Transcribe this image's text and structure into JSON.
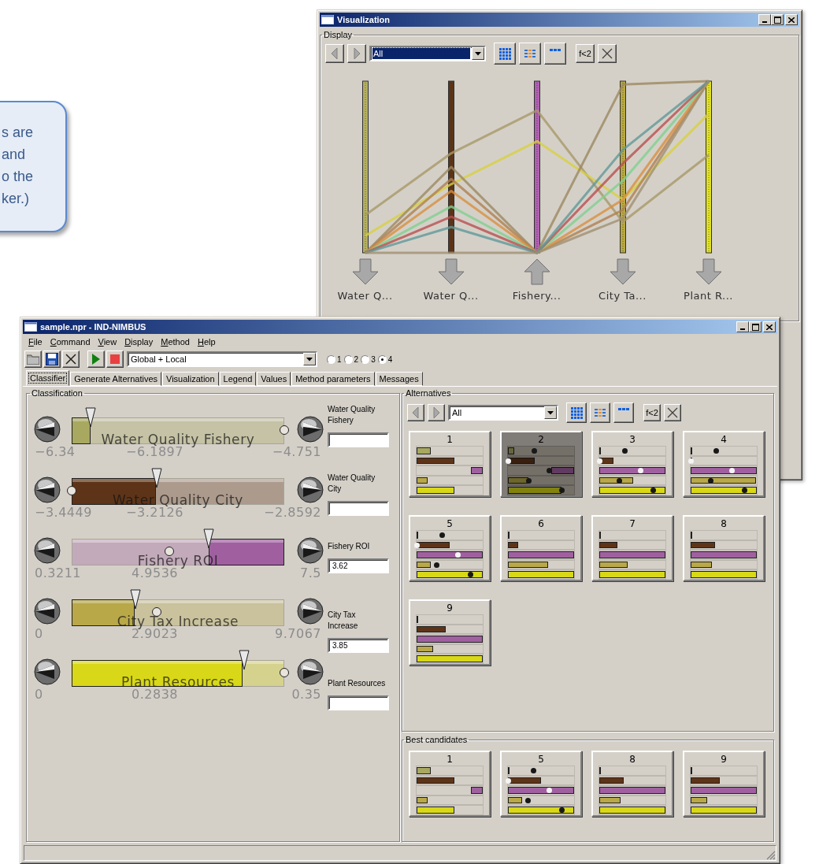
{
  "callout": {
    "lines": [
      "s are",
      "and",
      "o the",
      "ker.)"
    ]
  },
  "visualization": {
    "title": "Visualization",
    "group": "Display",
    "toolbar": {
      "filter": "All",
      "focused": true,
      "formula": "f<2"
    },
    "axes": [
      {
        "label": "Water Q...",
        "color": "#b4b060",
        "kind": "down"
      },
      {
        "label": "Water Q...",
        "color": "#5c3418",
        "kind": "down"
      },
      {
        "label": "Fishery...",
        "color": "#b060b0",
        "kind": "up"
      },
      {
        "label": "City Ta...",
        "color": "#b8a840",
        "kind": "down"
      },
      {
        "label": "Plant R...",
        "color": "#e0e020",
        "kind": "down"
      }
    ]
  },
  "main": {
    "title": "sample.npr - IND-NIMBUS",
    "menu": [
      "File",
      "Command",
      "View",
      "Display",
      "Method",
      "Help"
    ],
    "scope": "Global + Local",
    "radios": [
      {
        "label": "1",
        "selected": false
      },
      {
        "label": "2",
        "selected": false
      },
      {
        "label": "3",
        "selected": false
      },
      {
        "label": "4",
        "selected": true
      }
    ],
    "tabs": [
      {
        "label": "Classifier",
        "selected": true
      },
      {
        "label": "Generate Alternatives",
        "selected": false
      },
      {
        "label": "Visualization",
        "selected": false
      },
      {
        "label": "Legend",
        "selected": false
      },
      {
        "label": "Values",
        "selected": false
      },
      {
        "label": "Method parameters",
        "selected": false
      },
      {
        "label": "Messages",
        "selected": false
      }
    ],
    "classification": {
      "title": "Classification",
      "objectives": [
        {
          "name": "Water Quality Fishery",
          "min": "−6.34",
          "value": "−6.1897",
          "max": "−4.751",
          "side_label": "Water Quality Fishery",
          "color": "#a8a860",
          "kind": "left",
          "level": 0.09,
          "marker": {
            "level": 1
          }
        },
        {
          "name": "Water Quality City",
          "min": "−3.4449",
          "value": "−3.2126",
          "max": "−2.8592",
          "side_label": "Water Quality City",
          "color": "#5e3418",
          "kind": "left",
          "level": 0.4,
          "marker": {
            "level": 0
          }
        },
        {
          "name": "Fishery ROI",
          "min": "0.3211",
          "value": "4.9536",
          "max": "7.5",
          "side_label": "Fishery ROI",
          "field_value": "3.62",
          "color": "#a060a0",
          "kind": "right",
          "level": 0.645,
          "marker": {
            "level": 0.46
          }
        },
        {
          "name": "City Tax Increase",
          "min": "0",
          "value": "2.9023",
          "max": "9.7067",
          "side_label": "City Tax Increase",
          "field_value": "3.85",
          "color": "#b8a848",
          "kind": "left",
          "level": 0.3,
          "marker": {
            "level": 0.4
          }
        },
        {
          "name": "Plant Resources",
          "min": "0",
          "value": "0.2838",
          "max": "0.35",
          "side_label": "Plant Resources",
          "color": "#d8d818",
          "kind": "left",
          "level": 0.81,
          "marker": {
            "level": 1
          }
        }
      ]
    },
    "alternatives": {
      "title": "Alternatives",
      "toolbar": {
        "filter": "All",
        "focused": false,
        "formula": "f<2"
      },
      "cards": [
        {
          "label": "1",
          "selected": false,
          "bars": [
            {
              "level": 0.22
            },
            {
              "level": 0.57
            },
            {
              "level": 0.18
            },
            {
              "level": 0.17
            },
            {
              "level": 0.57
            }
          ]
        },
        {
          "label": "2",
          "selected": true,
          "bars": [
            {
              "level": 0.1,
              "dot": {
                "level": 0.4,
                "kind": "dark"
              }
            },
            {
              "level": 0.4,
              "dot": {
                "level": 0,
                "kind": "light"
              }
            },
            {
              "level": 0.35,
              "dot": {
                "level": 0.62,
                "kind": "dark"
              }
            },
            {
              "level": 0.31,
              "dot": {
                "level": 0.31,
                "kind": "dark"
              }
            },
            {
              "level": 0.81,
              "dot": {
                "level": 0.81,
                "kind": "dark"
              }
            }
          ]
        },
        {
          "label": "3",
          "selected": false,
          "bars": [
            {
              "level": 0,
              "dot": {
                "level": 0.39,
                "kind": "dark"
              }
            },
            {
              "level": 0.21,
              "dot": {
                "level": 0,
                "kind": "light"
              }
            },
            {
              "level": 1,
              "dot": {
                "level": 0.62,
                "kind": "light"
              }
            },
            {
              "level": 0.51,
              "dot": {
                "level": 0.3,
                "kind": "dark"
              }
            },
            {
              "level": 1,
              "dot": {
                "level": 0.81,
                "kind": "dark"
              }
            }
          ]
        },
        {
          "label": "4",
          "selected": false,
          "bars": [
            {
              "level": 0,
              "dot": {
                "level": 0.39,
                "kind": "dark"
              }
            },
            {
              "level": 0,
              "dot": {
                "level": 0,
                "kind": "light"
              }
            },
            {
              "level": 1,
              "dot": {
                "level": 0.62,
                "kind": "light"
              }
            },
            {
              "level": 0.99,
              "dot": {
                "level": 0.3,
                "kind": "dark"
              }
            },
            {
              "level": 1,
              "dot": {
                "level": 0.82,
                "kind": "dark"
              }
            }
          ]
        },
        {
          "label": "5",
          "selected": false,
          "bars": [
            {
              "level": 0,
              "dot": {
                "level": 0.39,
                "kind": "dark"
              }
            },
            {
              "level": 0.5,
              "dot": {
                "level": 0,
                "kind": "light"
              }
            },
            {
              "level": 1,
              "dot": {
                "level": 0.62,
                "kind": "light"
              }
            },
            {
              "level": 0.21,
              "dot": {
                "level": 0.3,
                "kind": "dark"
              }
            },
            {
              "level": 1,
              "dot": {
                "level": 0.81,
                "kind": "dark"
              }
            }
          ]
        },
        {
          "label": "6",
          "selected": false,
          "bars": [
            {
              "level": 0
            },
            {
              "level": 0.16
            },
            {
              "level": 1
            },
            {
              "level": 0.61
            },
            {
              "level": 1
            }
          ]
        },
        {
          "label": "7",
          "selected": false,
          "bars": [
            {
              "level": 0
            },
            {
              "level": 0.27
            },
            {
              "level": 1
            },
            {
              "level": 0.43
            },
            {
              "level": 1
            }
          ]
        },
        {
          "label": "8",
          "selected": false,
          "bars": [
            {
              "level": 0
            },
            {
              "level": 0.37
            },
            {
              "level": 1
            },
            {
              "level": 0.32
            },
            {
              "level": 1
            }
          ]
        },
        {
          "label": "9",
          "selected": false,
          "bars": [
            {
              "level": 0
            },
            {
              "level": 0.44
            },
            {
              "level": 1
            },
            {
              "level": 0.25
            },
            {
              "level": 1
            }
          ]
        }
      ]
    },
    "best_candidates": {
      "title": "Best candidates",
      "cards": [
        {
          "label": "1",
          "selected": false,
          "bars": [
            {
              "level": 0.22
            },
            {
              "level": 0.57
            },
            {
              "level": 0.18
            },
            {
              "level": 0.17
            },
            {
              "level": 0.57
            }
          ]
        },
        {
          "label": "5",
          "selected": false,
          "bars": [
            {
              "level": 0,
              "dot": {
                "level": 0.39,
                "kind": "dark"
              }
            },
            {
              "level": 0.5,
              "dot": {
                "level": 0,
                "kind": "light"
              }
            },
            {
              "level": 1,
              "dot": {
                "level": 0.62,
                "kind": "light"
              }
            },
            {
              "level": 0.21,
              "dot": {
                "level": 0.3,
                "kind": "dark"
              }
            },
            {
              "level": 1,
              "dot": {
                "level": 0.81,
                "kind": "dark"
              }
            }
          ]
        },
        {
          "label": "8",
          "selected": false,
          "bars": [
            {
              "level": 0
            },
            {
              "level": 0.37
            },
            {
              "level": 1
            },
            {
              "level": 0.32
            },
            {
              "level": 1
            }
          ]
        },
        {
          "label": "9",
          "selected": false,
          "bars": [
            {
              "level": 0
            },
            {
              "level": 0.44
            },
            {
              "level": 1
            },
            {
              "level": 0.25
            },
            {
              "level": 1
            }
          ]
        }
      ]
    }
  }
}
